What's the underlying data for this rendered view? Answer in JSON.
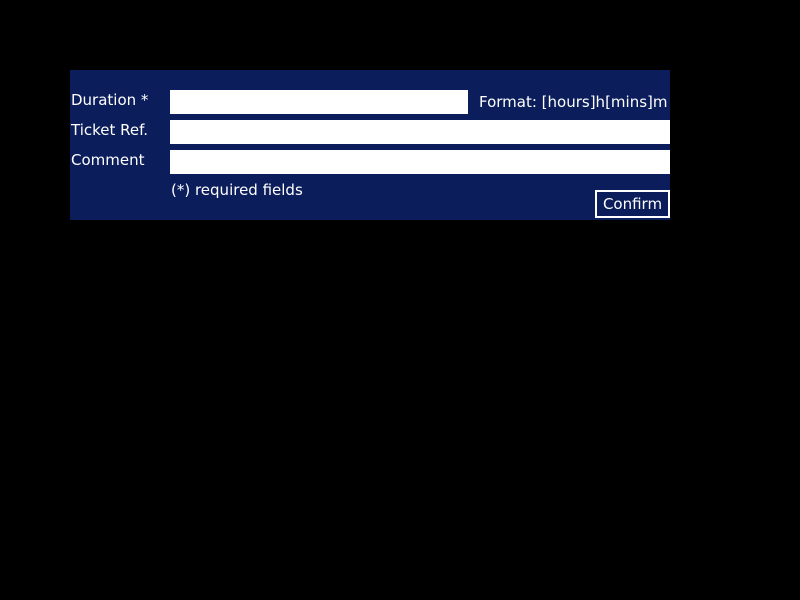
{
  "form": {
    "duration": {
      "label": "Duration *",
      "value": "",
      "format_hint": "Format: [hours]h[mins]m"
    },
    "ticket_ref": {
      "label": "Ticket Ref.",
      "value": ""
    },
    "comment": {
      "label": "Comment",
      "value": ""
    },
    "required_note": "(*) required fields",
    "confirm_label": "Confirm"
  },
  "colors": {
    "page_background": "#000000",
    "panel_background": "#0b1d5a",
    "text": "#ffffff",
    "field_background": "#ffffff"
  }
}
